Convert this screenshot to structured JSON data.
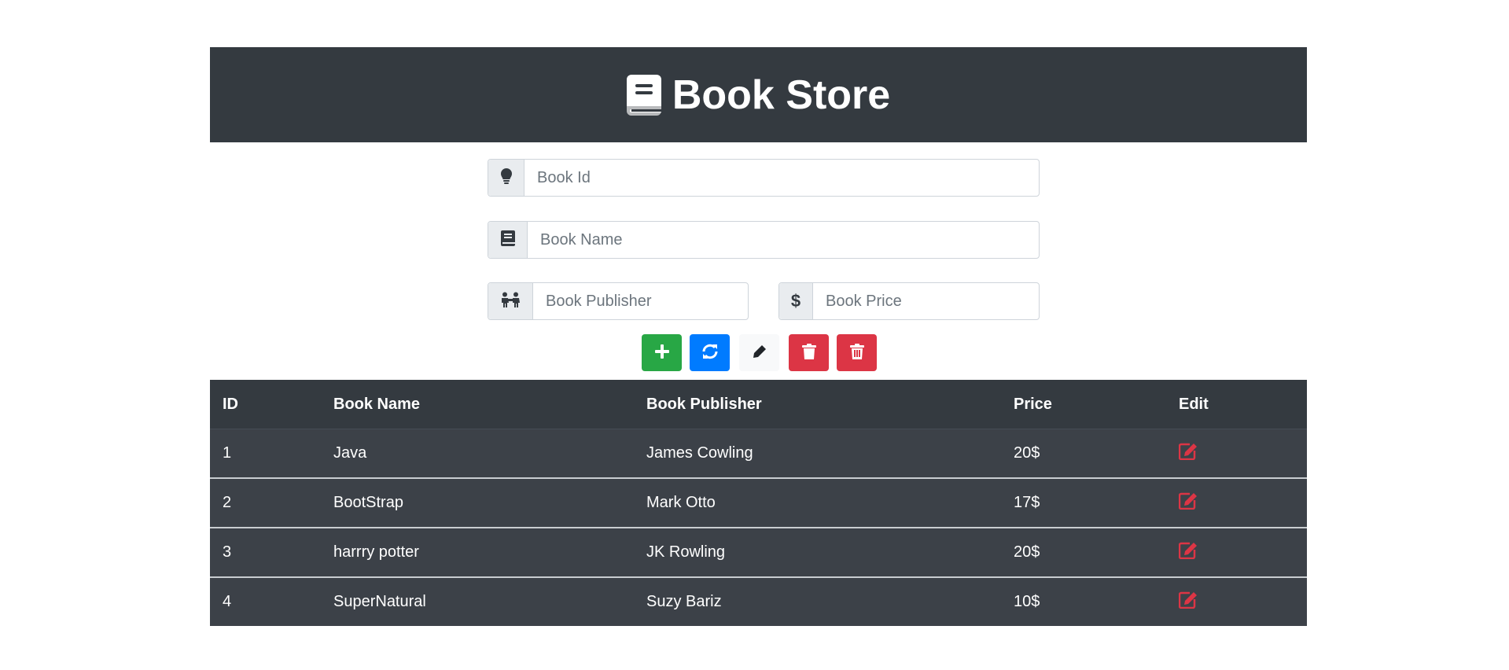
{
  "header": {
    "title": "Book Store",
    "icon": "book-icon"
  },
  "form": {
    "book_id": {
      "placeholder": "Book Id",
      "value": "",
      "icon": "lightbulb-icon"
    },
    "book_name": {
      "placeholder": "Book Name",
      "value": "",
      "icon": "book-icon"
    },
    "book_publisher": {
      "placeholder": "Book Publisher",
      "value": "",
      "icon": "people-icon"
    },
    "book_price": {
      "placeholder": "Book Price",
      "value": "",
      "icon": "dollar-icon"
    }
  },
  "actions": [
    {
      "name": "add",
      "icon": "plus-icon",
      "color": "#28a745"
    },
    {
      "name": "refresh",
      "icon": "sync-icon",
      "color": "#007bff"
    },
    {
      "name": "edit",
      "icon": "pen-icon",
      "color": "#f8f9fa"
    },
    {
      "name": "delete",
      "icon": "trash-icon",
      "color": "#dc3545"
    },
    {
      "name": "delete-all",
      "icon": "trash-icon",
      "color": "#dc3545"
    }
  ],
  "table": {
    "columns": [
      "ID",
      "Book Name",
      "Book Publisher",
      "Price",
      "Edit"
    ],
    "rows": [
      {
        "id": "1",
        "name": "Java",
        "publisher": "James Cowling",
        "price": "20$"
      },
      {
        "id": "2",
        "name": "BootStrap",
        "publisher": "Mark Otto",
        "price": "17$"
      },
      {
        "id": "3",
        "name": "harrry potter",
        "publisher": "JK Rowling",
        "price": "20$"
      },
      {
        "id": "4",
        "name": "SuperNatural",
        "publisher": "Suzy Bariz",
        "price": "10$"
      }
    ],
    "edit_icon": "edit-icon"
  },
  "colors": {
    "dark": "#343a40",
    "success": "#28a745",
    "primary": "#007bff",
    "light": "#f8f9fa",
    "danger": "#dc3545"
  }
}
